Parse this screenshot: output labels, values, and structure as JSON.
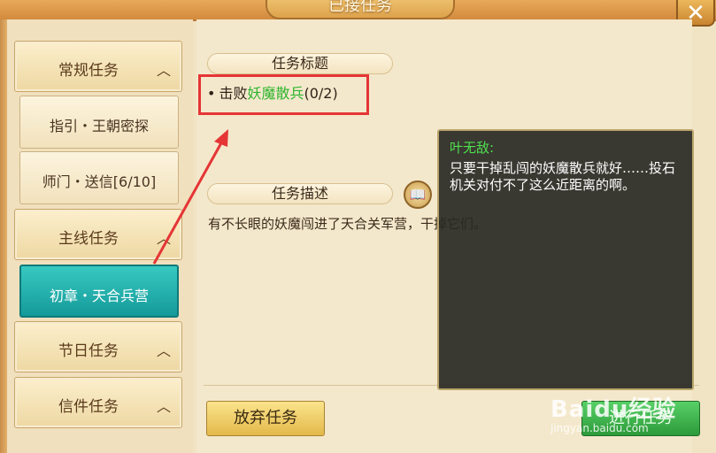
{
  "window": {
    "title": "已接任务",
    "close_icon": "close-icon"
  },
  "menu": {
    "categories": [
      {
        "label": "常规任务",
        "chevron": "chevron-up-icon"
      },
      {
        "label": "主线任务",
        "chevron": "chevron-up-icon"
      },
      {
        "label": "节日任务",
        "chevron": "chevron-up-icon"
      },
      {
        "label": "信件任务",
        "chevron": "chevron-up-icon"
      }
    ],
    "subitems": [
      {
        "label": "指引・王朝密探"
      },
      {
        "label": "师门・送信[6/10]"
      },
      {
        "label": "初章・天合兵营"
      }
    ]
  },
  "task": {
    "title_header": "任务标题",
    "objective_prefix": "击败",
    "objective_target": "妖魔散兵",
    "objective_progress": "(0/2)",
    "desc_header": "任务描述",
    "description": "有不长眼的妖魔闯进了天合关军营，干掉它们。"
  },
  "dialog": {
    "speaker": "叶无敌:",
    "text": "只要干掉乱闯的妖魔散兵就好……投石机关对付不了这么近距离的啊。"
  },
  "buttons": {
    "abandon": "放弃任务",
    "goto": "进行任务"
  },
  "watermark": {
    "main": "Baidu经验",
    "sub": "jingyan.baidu.com"
  },
  "colors": {
    "highlight": "#e53535",
    "target_text": "#2eb52e",
    "speaker": "#4ee24e",
    "active_tab": "#159a9a"
  }
}
